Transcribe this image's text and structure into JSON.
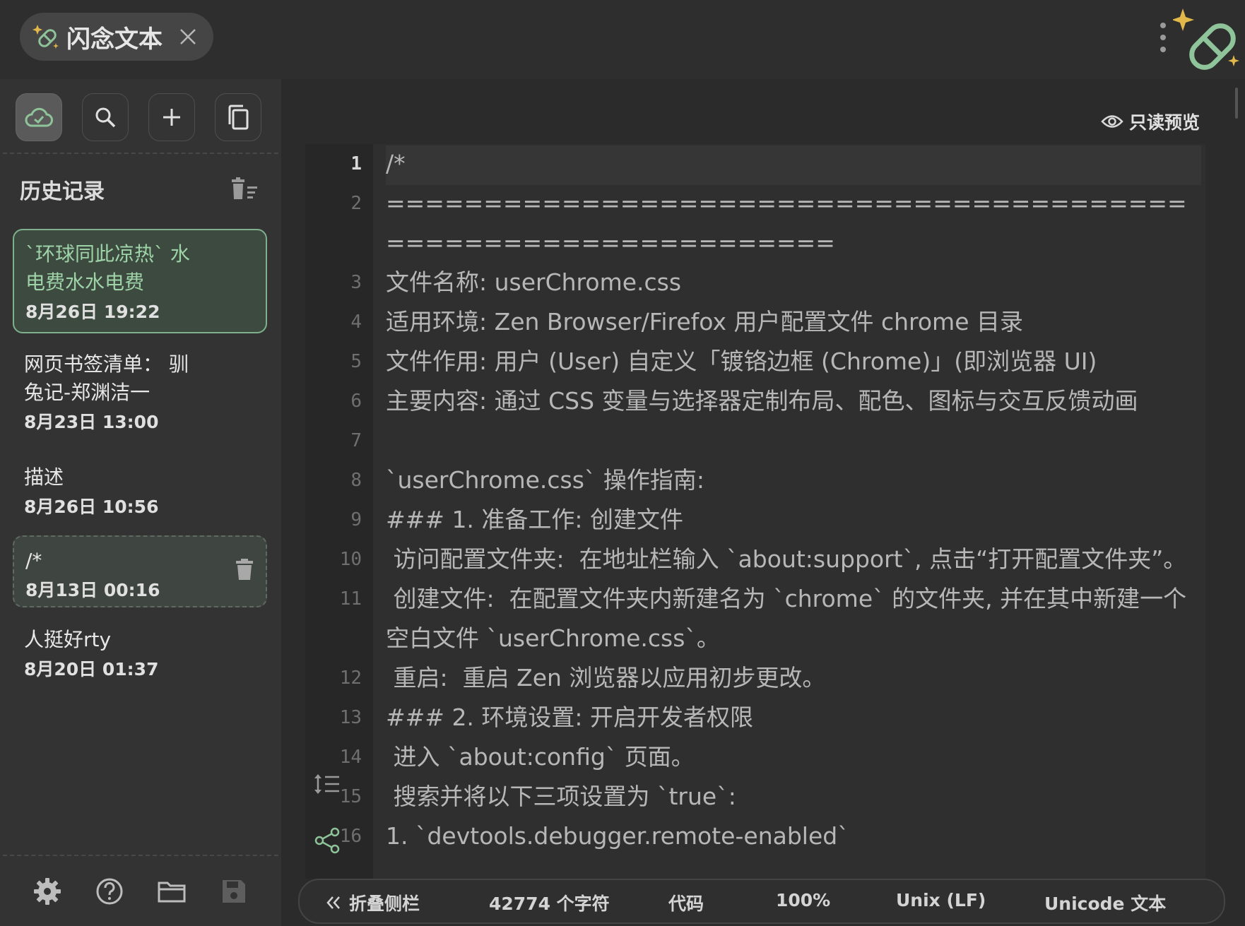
{
  "tab": {
    "title": "闪念文本",
    "icon": "sparkle-pill-icon"
  },
  "header": {
    "logo": "sparkle-pill-logo",
    "menu_icon": "vertical-dots-icon"
  },
  "toolbar": {
    "buttons": [
      "cloud-sync",
      "search",
      "add",
      "copy"
    ]
  },
  "history": {
    "title": "历史记录",
    "items": [
      {
        "title": "`环球同此凉热` 水\n电费水水电费",
        "date": "8月26日 19:22",
        "state": "selected"
      },
      {
        "title": "网页书签清单： 驯\n兔记-郑渊洁一",
        "date": "8月23日 13:00"
      },
      {
        "title": "描述",
        "date": "8月26日 10:56"
      },
      {
        "title": "/*",
        "date": "8月13日 00:16",
        "state": "hover"
      },
      {
        "title": "人挺好rty",
        "date": "8月20日 01:37"
      }
    ]
  },
  "bottom_icons": [
    "settings-icon",
    "help-icon",
    "folder-icon",
    "save-icon"
  ],
  "editor": {
    "preview_label": "只读预览",
    "current_line": 1,
    "lines": [
      {
        "n": "1",
        "text": "/*"
      },
      {
        "n": "2",
        "text": "================================================================"
      },
      {
        "n": "3",
        "text": "文件名称: userChrome.css"
      },
      {
        "n": "4",
        "text": "适用环境: Zen Browser/Firefox 用户配置文件 chrome 目录"
      },
      {
        "n": "5",
        "text": "文件作用: 用户 (User) 自定义「镀铬边框 (Chrome)」(即浏览器 UI)"
      },
      {
        "n": "6",
        "text": "主要内容: 通过 CSS 变量与选择器定制布局、配色、图标与交互反馈动画"
      },
      {
        "n": "7",
        "text": ""
      },
      {
        "n": "8",
        "text": "`userChrome.css` 操作指南:"
      },
      {
        "n": "9",
        "text": "### 1. 准备工作: 创建文件"
      },
      {
        "n": "10",
        "text": " 访问配置文件夹:  在地址栏输入 `about:support`, 点击“打开配置文件夹”。"
      },
      {
        "n": "11",
        "text": " 创建文件:  在配置文件夹内新建名为 `chrome` 的文件夹, 并在其中新建一个空白文件 `userChrome.css`。"
      },
      {
        "n": "12",
        "text": " 重启:  重启 Zen 浏览器以应用初步更改。"
      },
      {
        "n": "13",
        "text": "### 2. 环境设置: 开启开发者权限"
      },
      {
        "n": "14",
        "text": " 进入 `about:config` 页面。"
      },
      {
        "n": "15",
        "text": " 搜索并将以下三项设置为 `true`:"
      },
      {
        "n": "16",
        "text": "1. `devtools.debugger.remote-enabled`"
      }
    ]
  },
  "statusbar": {
    "collapse_label": "折叠侧栏",
    "char_count": "42774 个字符",
    "language": "代码",
    "zoom": "100%",
    "line_ending": "Unix (LF)",
    "encoding": "Unicode 文本"
  },
  "colors": {
    "accent": "#7fb08c",
    "star": "#e2b84a",
    "background": "#2b2b2b"
  }
}
